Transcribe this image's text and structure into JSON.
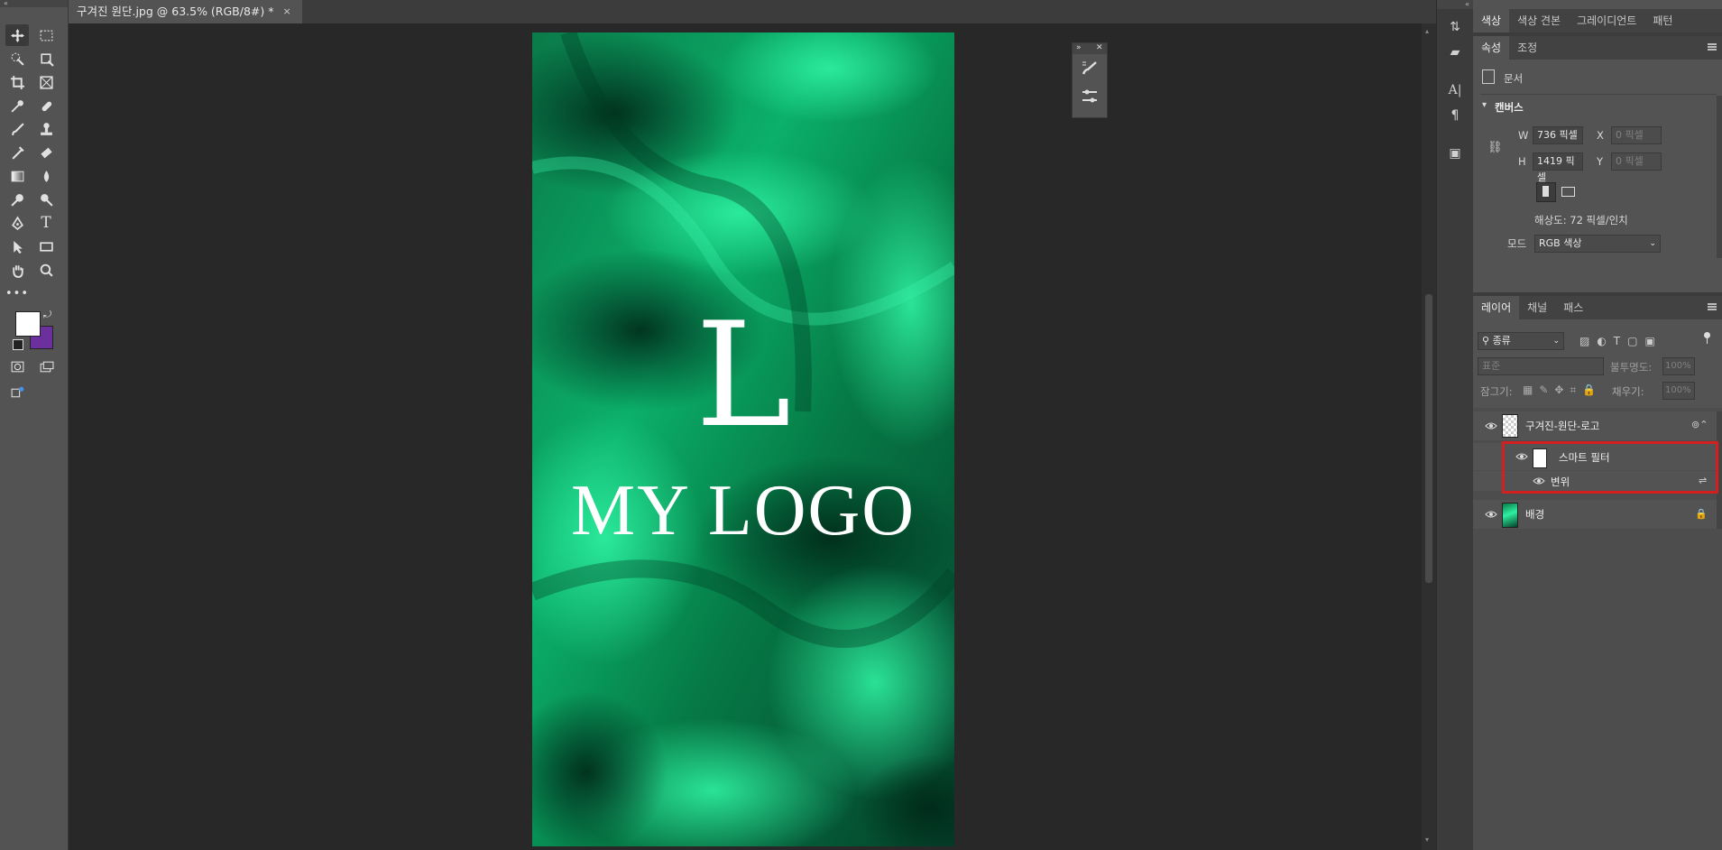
{
  "document_tab": {
    "title": "구겨진 원단.jpg @ 63.5% (RGB/8#) *",
    "close": "×"
  },
  "artwork": {
    "logo_letter": "L",
    "logo_text": "MY LOGO"
  },
  "colors": {
    "foreground": "#ffffff",
    "background": "#6b2f9e",
    "canvas_green": "#07a05c"
  },
  "top_panel_tabs": [
    "색상",
    "색상 견본",
    "그레이디언트",
    "패턴"
  ],
  "properties": {
    "tabs": [
      "속성",
      "조정"
    ],
    "doc_label": "문서",
    "section_title": "캔버스",
    "w_label": "W",
    "w_value": "736 픽셀",
    "h_label": "H",
    "h_value": "1419 픽셀",
    "x_label": "X",
    "x_placeholder": "0 픽셀",
    "y_label": "Y",
    "y_placeholder": "0 픽셀",
    "resolution": "해상도: 72 픽셀/인치",
    "mode_label": "모드",
    "mode_value": "RGB 색상"
  },
  "layers_panel": {
    "tabs": [
      "레이어",
      "채널",
      "패스"
    ],
    "filter_kind": "종류",
    "blend_mode": "표준",
    "opacity_label": "불투명도:",
    "opacity_value": "100%",
    "lock_label": "잠그기:",
    "fill_label": "채우기:",
    "fill_value": "100%",
    "layers": [
      {
        "name": "구겨진-원단-로고"
      },
      {
        "name": "스마트 필터"
      },
      {
        "name": "변위"
      },
      {
        "name": "배경"
      }
    ]
  },
  "tool_icons": [
    "move-icon",
    "marquee-icon",
    "quick-selection-icon",
    "artboard-icon",
    "crop-icon",
    "frame-icon",
    "eyedropper-icon",
    "healing-icon",
    "brush-icon",
    "stamp-icon",
    "history-brush-icon",
    "eraser-icon",
    "gradient-icon",
    "blur-icon",
    "dodge-icon",
    "smudge-icon",
    "pen-icon",
    "type-icon",
    "path-selection-icon",
    "rectangle-icon",
    "hand-icon",
    "zoom-icon",
    "more-tools-icon"
  ]
}
